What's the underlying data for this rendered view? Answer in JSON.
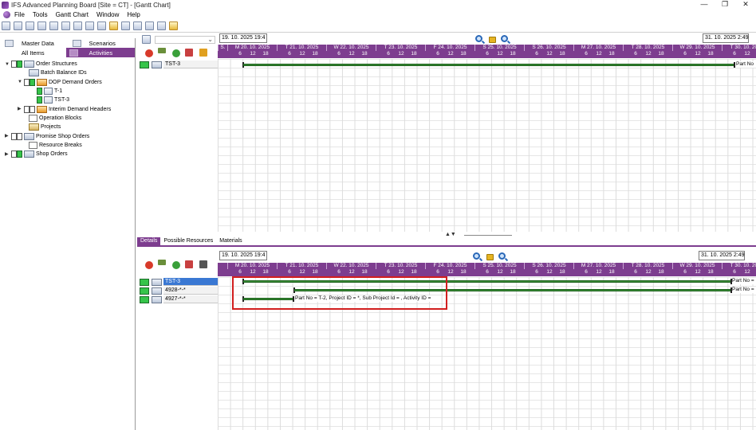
{
  "window": {
    "title": "IFS Advanced Planning Board [Site = CT] - [Gantt Chart]",
    "controls": {
      "minimize": "—",
      "maximize": "❐",
      "close": "✕"
    }
  },
  "menu": [
    "File",
    "Tools",
    "Gantt Chart",
    "Window",
    "Help"
  ],
  "left_panel": {
    "tabs_top": [
      "Master Data",
      "Scenarios"
    ],
    "tabs_bottom": [
      "All Items",
      "Activities"
    ],
    "tree": [
      {
        "label": "Order Structures",
        "level": 0
      },
      {
        "label": "Batch Balance IDs",
        "level": 1
      },
      {
        "label": "DOP Demand Orders",
        "level": 1
      },
      {
        "label": "T-1",
        "level": 2
      },
      {
        "label": "TST-3",
        "level": 2
      },
      {
        "label": "Interim Demand Headers",
        "level": 1
      },
      {
        "label": "Operation Blocks",
        "level": 1
      },
      {
        "label": "Projects",
        "level": 1
      },
      {
        "label": "Promise Shop Orders",
        "level": 0
      },
      {
        "label": "Resource Breaks",
        "level": 1
      },
      {
        "label": "Shop Orders",
        "level": 0
      }
    ]
  },
  "top_gantt": {
    "start_date": "19. 10. 2025 19:4",
    "end_date": "31. 10. 2025 2:49",
    "days": [
      "S.",
      "M 20. 10. 2025",
      "T 21. 10. 2025",
      "W 22. 10. 2025",
      "T 23. 10. 2025",
      "F 24. 10. 2025",
      "S 25. 10. 2025",
      "S 26. 10. 2025",
      "M 27. 10. 2025",
      "T 28. 10. 2025",
      "W 29. 10. 2025",
      "T 30. 10. 2025",
      "F"
    ],
    "hours": [
      "6",
      "12",
      "18"
    ],
    "rows": [
      {
        "label": "TST-3",
        "bar_label": "Part No"
      }
    ]
  },
  "detail_tabs": [
    "Details",
    "Possible Resources",
    "Materials"
  ],
  "bottom_gantt": {
    "start_date": "19. 10. 2025 19:4",
    "end_date": "31. 10. 2025 2:49",
    "days": [
      "",
      "M 20. 10. 2025",
      "T 21. 10. 2025",
      "W 22. 10. 2025",
      "T 23. 10. 2025",
      "F 24. 10. 2025",
      "S 25. 10. 2025",
      "S 26. 10. 2025",
      "M 27. 10. 2025",
      "T 28. 10. 2025",
      "W 29. 10. 2025",
      "T 30. 10. 2025",
      ""
    ],
    "hours": [
      "6",
      "12",
      "18"
    ],
    "rows": [
      {
        "label": "TST-3",
        "bar_label": "Part No ="
      },
      {
        "label": "4928-*-*",
        "bar_label": "Part No ="
      },
      {
        "label": "4927-*-*",
        "bar_label": "Part No = T-2, Project ID = *, Sub Project Id = , Activity ID ="
      }
    ]
  },
  "colors": {
    "accent": "#7d3d8f",
    "bar": "#3d8f3a",
    "selection": "#3a78d3",
    "highlight_box": "#d21f1f"
  }
}
